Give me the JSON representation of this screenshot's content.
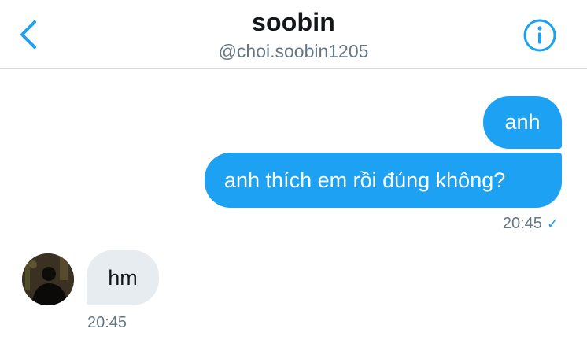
{
  "header": {
    "title": "soobin",
    "handle": "@choi.soobin1205"
  },
  "messages": [
    {
      "direction": "out",
      "text": "anh"
    },
    {
      "direction": "out",
      "text": "anh thích em rồi đúng không?",
      "time": "20:45",
      "status": "✓"
    },
    {
      "direction": "in",
      "text": "hm",
      "time": "20:45"
    }
  ],
  "icons": {
    "back": "chevron-left-icon",
    "info": "info-icon",
    "read": "check-icon"
  },
  "colors": {
    "accent": "#1da1f2",
    "incoming_bubble": "#e6ecf0",
    "muted_text": "#657786"
  }
}
